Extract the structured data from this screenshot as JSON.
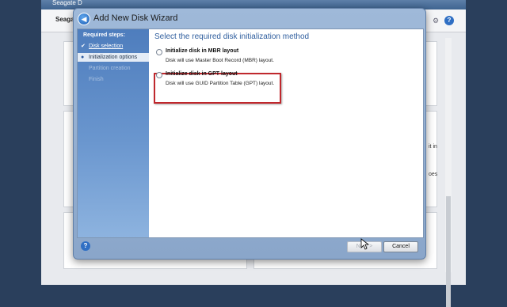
{
  "background_app": {
    "title": "Seagate D",
    "toolbar_label": "Seagate",
    "snippets": [
      "it in",
      "oes"
    ]
  },
  "wizard": {
    "title": "Add New Disk Wizard",
    "heading": "Select the required disk initialization method",
    "sidebar": {
      "heading": "Required steps:",
      "steps": [
        {
          "label": "Disk selection",
          "state": "done",
          "mark": "✔"
        },
        {
          "label": "Initialization options",
          "state": "current",
          "mark": "●"
        },
        {
          "label": "Partition creation",
          "state": "future",
          "mark": ""
        },
        {
          "label": "Finish",
          "state": "future",
          "mark": ""
        }
      ]
    },
    "options": [
      {
        "title": "Initialize disk in MBR layout",
        "description": "Disk will use Master Boot Record (MBR) layout.",
        "selected": false
      },
      {
        "title": "Initialize disk in GPT layout",
        "description": "Disk will use GUID Partition Table (GPT) layout.",
        "selected": false
      }
    ],
    "buttons": {
      "next": "Next >",
      "cancel": "Cancel"
    }
  },
  "colors": {
    "accent": "#2f5e9e",
    "highlight": "#c0282d",
    "sidebar": "#4e7dbd"
  }
}
